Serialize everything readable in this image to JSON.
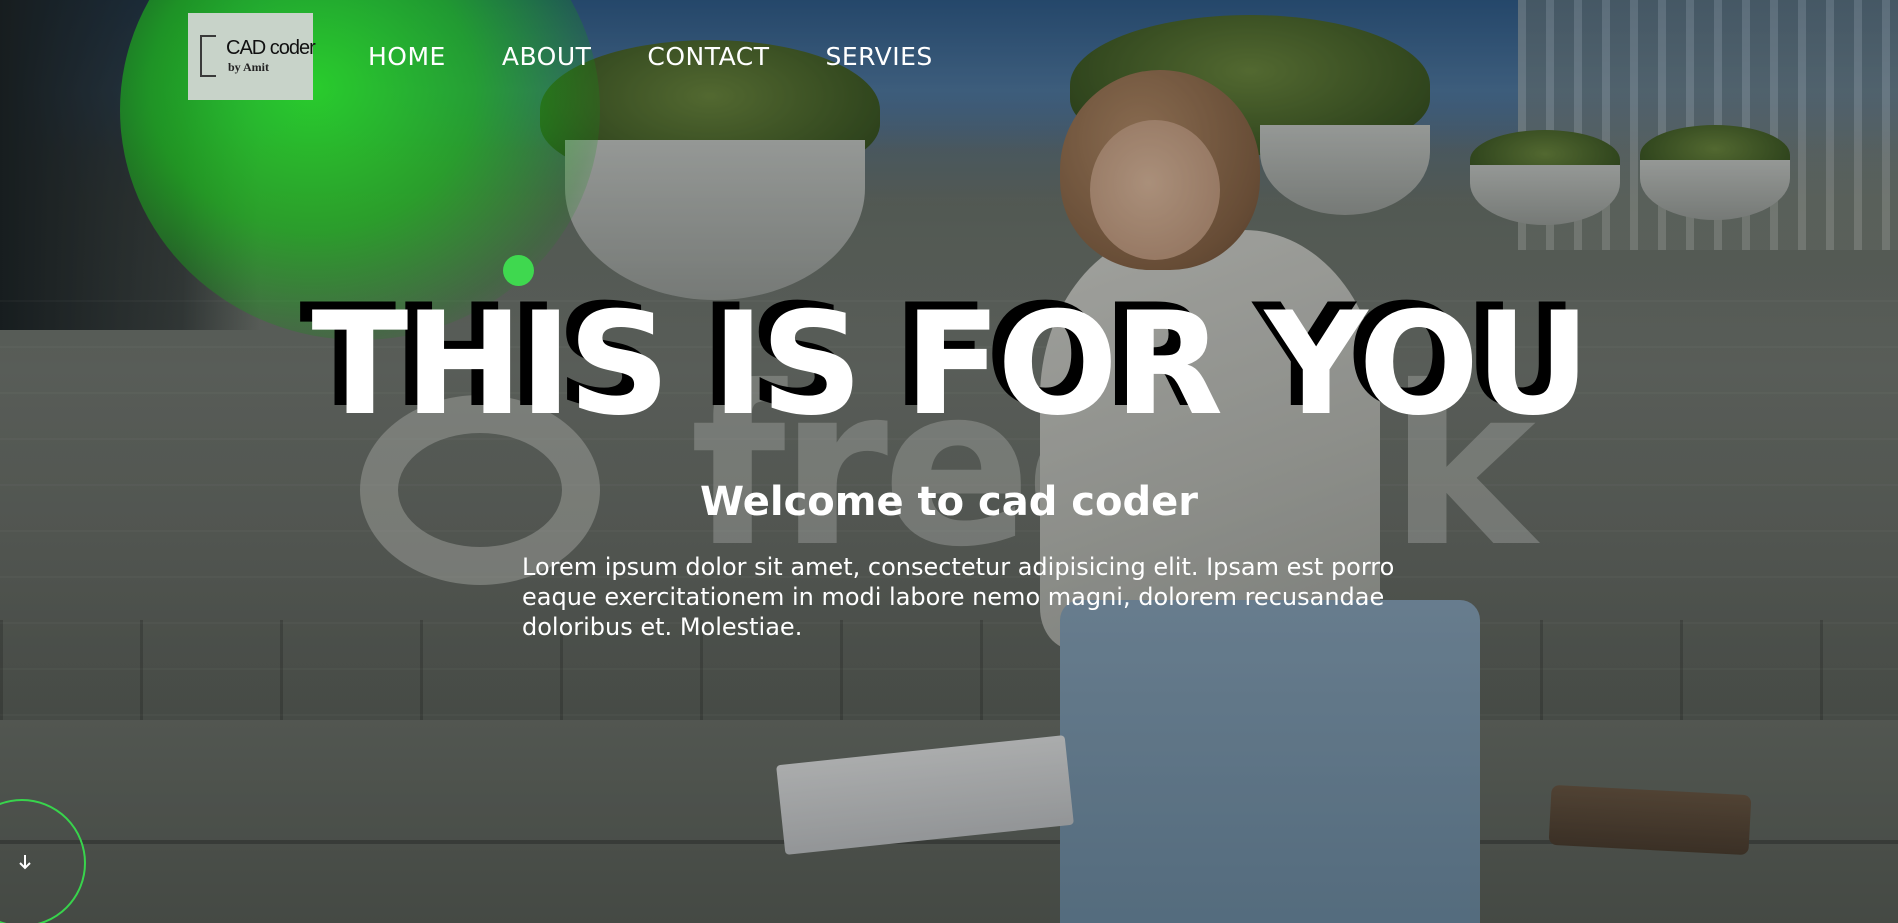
{
  "logo": {
    "title": "CAD coder",
    "subtitle": "by Amit",
    "icon": "cad-drafting-icon"
  },
  "nav": {
    "items": [
      {
        "label": "HOME"
      },
      {
        "label": "ABOUT"
      },
      {
        "label": "CONTACT"
      },
      {
        "label": "SERVIES"
      }
    ]
  },
  "hero": {
    "headline": "THIS IS FOR YOU",
    "subheading": "Welcome to cad coder",
    "paragraph": "Lorem ipsum dolor sit amet, consectetur adipisicing elit. Ipsam est porro eaque exercitationem in modi labore nemo magni, dolorem recusandae doloribus et. Molestiae.",
    "background_watermark": "freepik"
  },
  "scroll": {
    "icon": "arrow-down-icon"
  },
  "colors": {
    "accent_green": "#3fd84f",
    "text": "#ffffff",
    "headline_shadow": "#000000",
    "logo_background": "#c8d3c9"
  }
}
